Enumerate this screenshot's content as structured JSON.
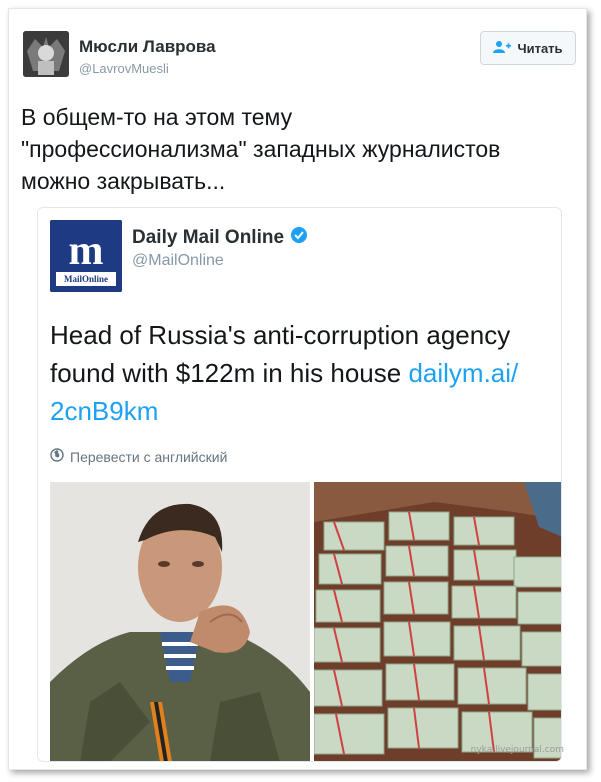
{
  "tweet": {
    "author_name": "Мюсли Лаврова",
    "author_handle": "@LavrovMuesli",
    "follow_label": "Читать",
    "text_line1": "В общем-то на этом тему",
    "text_line2": "\"профессионализма\" западных журналистов",
    "text_line3": "можно закрывать..."
  },
  "quoted": {
    "logo_text": "MailOnline",
    "name": "Daily Mail Online",
    "handle": "@MailOnline",
    "verified_icon": "verified-badge-icon",
    "text_line1": "Head of Russia's anti-corruption agency",
    "text_line2": "found with $122m in his house ",
    "link_part1": "dailym.ai/",
    "link_part2": "2cnB9km",
    "translate_label": "Перевести с английский"
  },
  "icons": {
    "follow": "add-user-icon",
    "translate": "globe-icon"
  },
  "colors": {
    "link": "#1da1f2",
    "verified": "#1da1f2",
    "dm_brand": "#1d3a82"
  },
  "watermark": "nyka.livejournal.com"
}
